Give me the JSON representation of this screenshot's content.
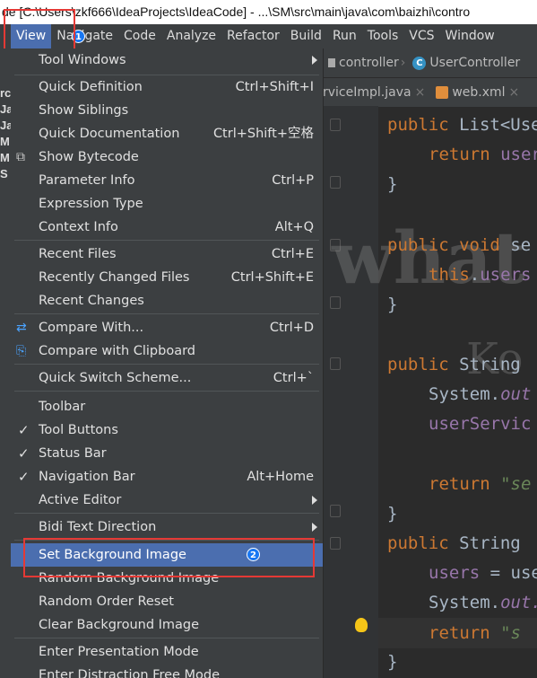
{
  "window_title": "de [C:\\Users\\zkf666\\IdeaProjects\\IdeaCode] - ...\\SM\\src\\main\\java\\com\\baizhi\\contro",
  "menubar": {
    "items": [
      "View",
      "Navigate",
      "Code",
      "Analyze",
      "Refactor",
      "Build",
      "Run",
      "Tools",
      "VCS",
      "Window"
    ],
    "active": "View"
  },
  "annotations": {
    "badge_1": "1",
    "badge_2": "2",
    "box_color": "#e53935",
    "badge_color": "#1877f2"
  },
  "navbar": {
    "crumb1": "controller",
    "crumb2": "UserController",
    "crumb2_icon": "C"
  },
  "tabs": {
    "tab1": "rviceImpl.java",
    "tab2": "web.xml"
  },
  "code_lines": {
    "l1a": "public ",
    "l1b": "List<Use",
    "l2a": "return ",
    "l2b": "user",
    "l3": "}",
    "l4a": "public ",
    "l4b": "void ",
    "l4c": "se",
    "l5a": "this",
    "l5b": ".",
    "l5c": "users",
    "l6": "}",
    "l7a": "public ",
    "l7b": "String",
    "l8a": "System.",
    "l8b": "out",
    "l9": "userServic",
    "l10a": "return ",
    "l10b": "\"se",
    "l11": "}",
    "l12a": "public ",
    "l12b": "String ",
    "l13a": "users",
    "l13b": " = use",
    "l14a": "System.",
    "l14b": "out.",
    "l15a": "return ",
    "l15b": "\"s",
    "l16": "}"
  },
  "watermark": {
    "big": "what",
    "small": "Ko"
  },
  "left_gutter_letters": [
    "rc",
    "Ja",
    "Ja",
    "M",
    "M",
    "S"
  ],
  "view_menu": {
    "tool_windows": "Tool Windows",
    "quick_definition": "Quick Definition",
    "quick_definition_sc": "Ctrl+Shift+I",
    "show_siblings": "Show Siblings",
    "quick_documentation": "Quick Documentation",
    "quick_documentation_sc": "Ctrl+Shift+空格",
    "show_bytecode": "Show Bytecode",
    "parameter_info": "Parameter Info",
    "parameter_info_sc": "Ctrl+P",
    "expression_type": "Expression Type",
    "context_info": "Context Info",
    "context_info_sc": "Alt+Q",
    "recent_files": "Recent Files",
    "recent_files_sc": "Ctrl+E",
    "recently_changed_files": "Recently Changed Files",
    "recently_changed_files_sc": "Ctrl+Shift+E",
    "recent_changes": "Recent Changes",
    "compare_with": "Compare With...",
    "compare_with_sc": "Ctrl+D",
    "compare_with_clipboard": "Compare with Clipboard",
    "quick_switch_scheme": "Quick Switch Scheme...",
    "quick_switch_scheme_sc": "Ctrl+`",
    "toolbar": "Toolbar",
    "tool_buttons": "Tool Buttons",
    "status_bar": "Status Bar",
    "navigation_bar": "Navigation Bar",
    "navigation_bar_sc": "Alt+Home",
    "active_editor": "Active Editor",
    "bidi_text_direction": "Bidi Text Direction",
    "set_background_image": "Set Background Image",
    "random_background_image": "Random Background Image",
    "random_order_reset": "Random Order Reset",
    "clear_background_image": "Clear Background Image",
    "enter_presentation_mode": "Enter Presentation Mode",
    "enter_distraction_free_mode": "Enter Distraction Free Mode",
    "checkmark": "✓"
  }
}
